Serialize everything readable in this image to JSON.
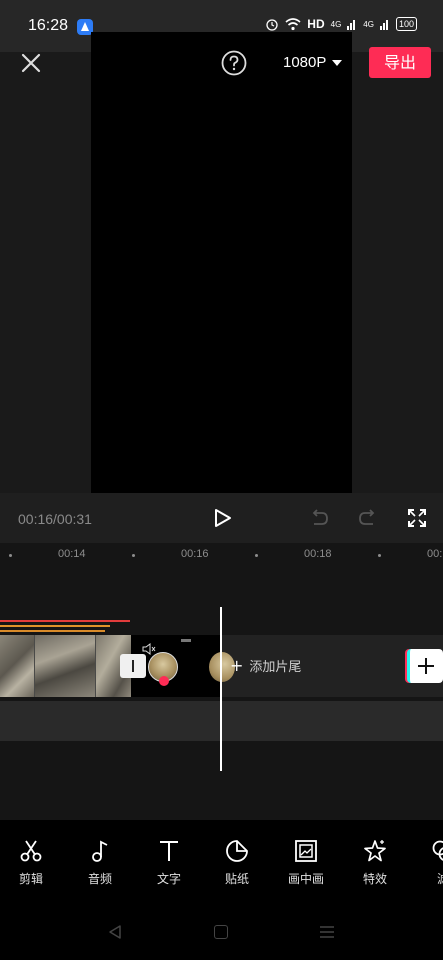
{
  "status_bar": {
    "time": "16:28",
    "indicators": "HD",
    "signal_1": "4G",
    "signal_2": "4G",
    "battery": "100"
  },
  "header": {
    "resolution": "1080P",
    "export_label": "导出",
    "accent_color": "#fe2c55"
  },
  "playback": {
    "time_readout": "00:16/00:31"
  },
  "timeline": {
    "ruler_labels": [
      "00:14",
      "00:16",
      "00:18",
      "00:"
    ],
    "add_ending_label": "添加片尾",
    "add_ending_plus": "+"
  },
  "toolbar": {
    "items": [
      {
        "label": "剪辑",
        "icon": "scissors-icon"
      },
      {
        "label": "音频",
        "icon": "music-note-icon"
      },
      {
        "label": "文字",
        "icon": "text-icon"
      },
      {
        "label": "贴纸",
        "icon": "sticker-icon"
      },
      {
        "label": "画中画",
        "icon": "picture-in-picture-icon"
      },
      {
        "label": "特效",
        "icon": "effects-star-icon"
      },
      {
        "label": "滤",
        "icon": "filter-icon"
      }
    ]
  }
}
